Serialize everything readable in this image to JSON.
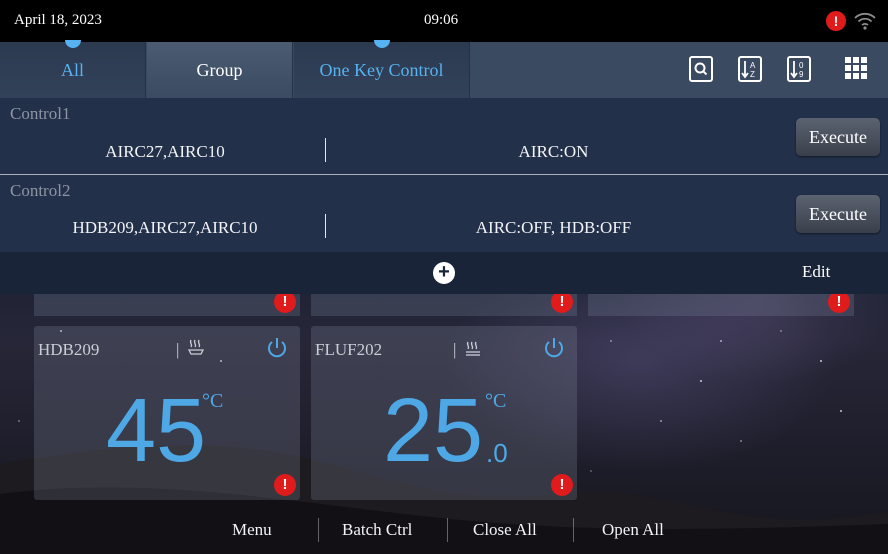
{
  "status_bar": {
    "date": "April 18, 2023",
    "time": "09:06",
    "alarm_glyph": "!",
    "alarm_color": "#e01b1b",
    "wifi_icon": "wifi-icon"
  },
  "tabs": [
    {
      "label": "All",
      "active": true
    },
    {
      "label": "Group",
      "active": false
    },
    {
      "label": "One Key Control",
      "active": true
    }
  ],
  "toolbar": {
    "icons": [
      "search-icon",
      "sort-alpha-icon",
      "sort-numeric-icon",
      "grid-view-icon"
    ]
  },
  "one_key_control": {
    "controls": [
      {
        "name": "Control1",
        "devices": "AIRC27,AIRC10",
        "actions": "AIRC:ON",
        "button": "Execute"
      },
      {
        "name": "Control2",
        "devices": "HDB209,AIRC27,AIRC10",
        "actions": "AIRC:OFF, HDB:OFF",
        "button": "Execute"
      }
    ],
    "add_glyph": "+",
    "edit_label": "Edit"
  },
  "devices": [
    {
      "name": "HDB209",
      "mode_icon": "heating-icon",
      "temperature": "45",
      "unit": "°C",
      "decimal": "",
      "error": true
    },
    {
      "name": "FLUF202",
      "mode_icon": "floor-heating-icon",
      "temperature": "25",
      "unit": "°C",
      "decimal": ".0",
      "error": true
    }
  ],
  "error_glyph": "!",
  "accent_color": "#4ea8e6",
  "bottom_menu": {
    "menu": "Menu",
    "batch_ctrl": "Batch Ctrl",
    "close_all": "Close All",
    "open_all": "Open All"
  }
}
